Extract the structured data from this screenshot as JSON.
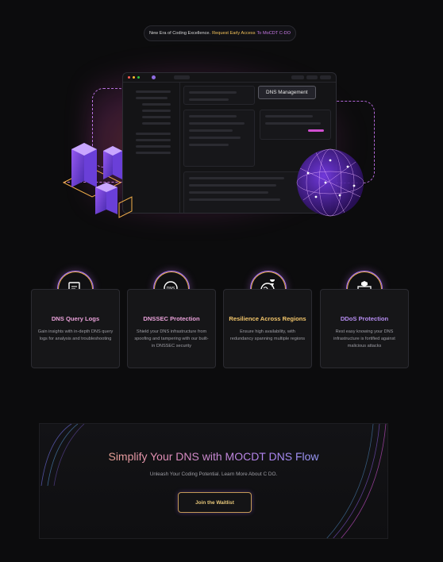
{
  "announcement": {
    "lead": "New Era of Coding Excellence.",
    "highlight": "Request Early Access",
    "tail": "To MoCDT C-DO"
  },
  "hero": {
    "tooltip": "DNS Management",
    "window_dot_colors": [
      "#ff5f57",
      "#febc2e",
      "#28c840"
    ]
  },
  "features": [
    {
      "icon": "dns-log-icon",
      "title": "DNS Query Logs",
      "title_color": "#e8a0d8",
      "desc": "Gain insights with in-depth DNS query logs for analysis and troubleshooting"
    },
    {
      "icon": "dnssec-lock-icon",
      "title": "DNSSEC Protection",
      "title_color": "#e8a0d8",
      "desc": "Shield your DNS infrastructure from spoofing and tampering with our built-in DNSSEC security"
    },
    {
      "icon": "globe-pin-icon",
      "title": "Resilience Across Regions",
      "title_color": "#f2c56a",
      "desc": "Ensure high availability, with redundancy spanning multiple regions"
    },
    {
      "icon": "server-shield-icon",
      "title": "DDoS Protection",
      "title_color": "#b58cf0",
      "desc": "Rest easy knowing your DNS infrastructure is fortified against malicious attacks"
    }
  ],
  "cta": {
    "title": "Simplify Your DNS with MOCDT DNS Flow",
    "subtitle": "Unleash Your Coding Potential. Learn More About C DO.",
    "button": "Join the Waitlist"
  }
}
